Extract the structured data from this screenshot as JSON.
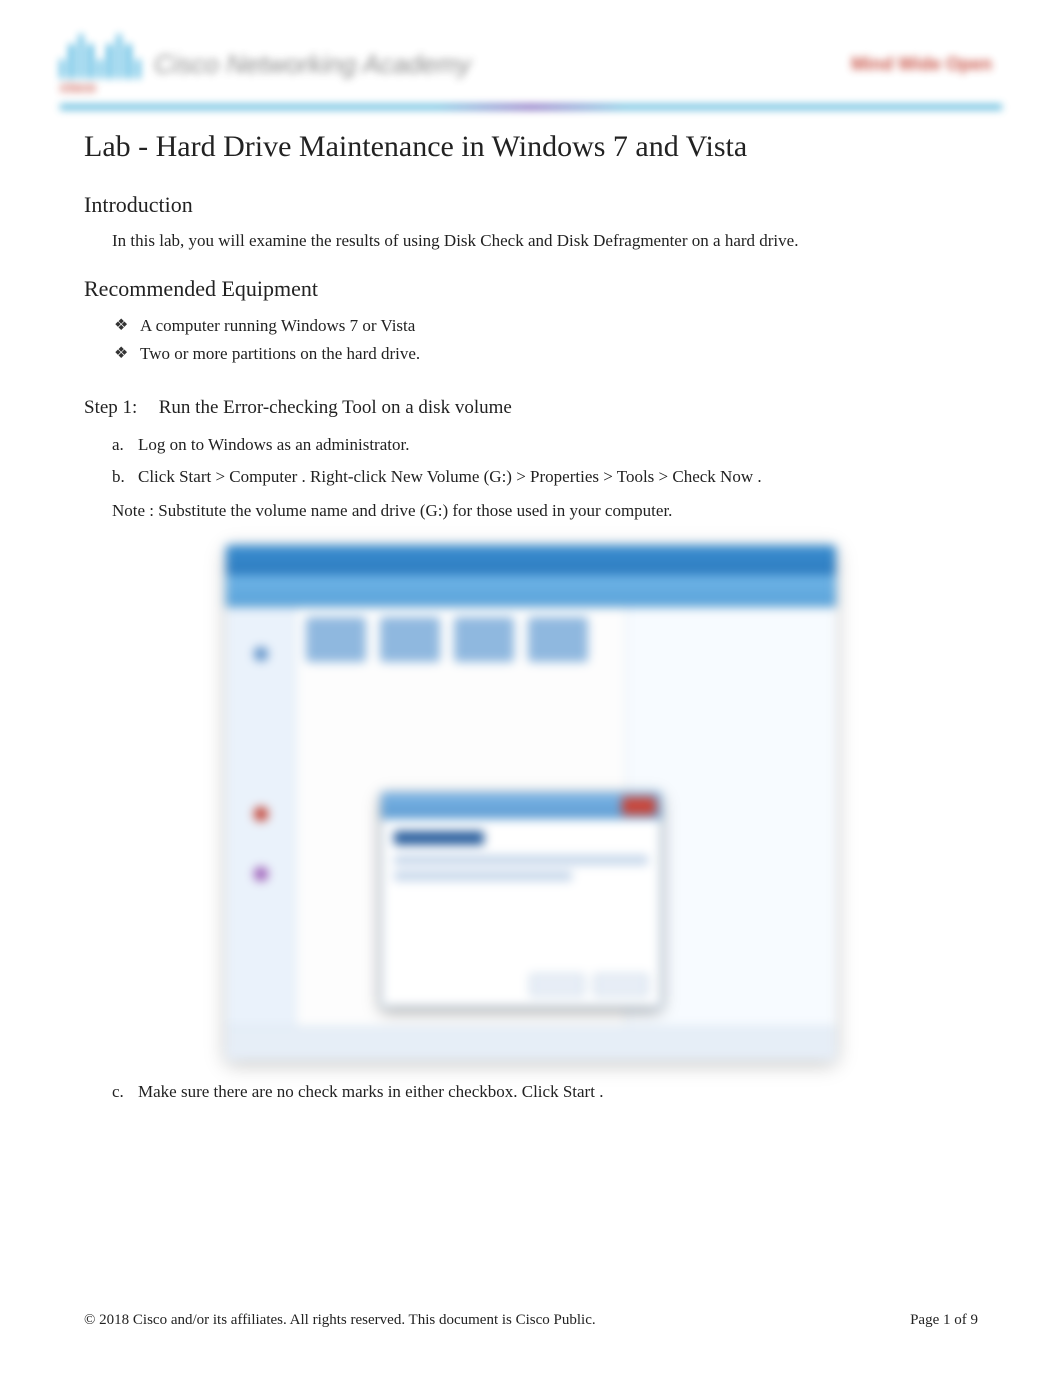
{
  "header": {
    "logo_sub": "cisco",
    "academy": "Cisco Networking Academy",
    "brand_right": "Mind Wide Open"
  },
  "title": "Lab - Hard Drive Maintenance in Windows 7 and Vista",
  "sections": {
    "intro_heading": "Introduction",
    "intro_text": "In this lab, you will examine the results of using Disk Check and Disk Defragmenter on a hard drive.",
    "equip_heading": "Recommended Equipment",
    "equip_items": [
      "A computer running Windows 7 or Vista",
      "Two or more partitions on the hard drive."
    ]
  },
  "step1": {
    "label": "Step 1:",
    "heading": "Run the Error-checking Tool on a disk volume",
    "items": {
      "a_marker": "a.",
      "a": "Log on to Windows as an administrator.",
      "b_marker": "b.",
      "b_pre": "Click ",
      "b_path1": "Start > Computer",
      "b_mid": " . Right-click ",
      "b_path2": "New Volume (G:) > Properties > Tools > Check Now",
      "b_post": " .",
      "note_label": "Note",
      "note_text": " : Substitute the volume name and drive (G:) for those used in your computer.",
      "c_marker": "c.",
      "c_pre": "Make sure there are no check marks in either checkbox. Click ",
      "c_btn": "Start",
      "c_post": " ."
    }
  },
  "footer": {
    "copyright": "© 2018 Cisco and/or its affiliates. All rights reserved. This document is Cisco Public.",
    "page_label": "Page ",
    "page_current": "1",
    "page_sep": " of ",
    "page_total": "9"
  }
}
